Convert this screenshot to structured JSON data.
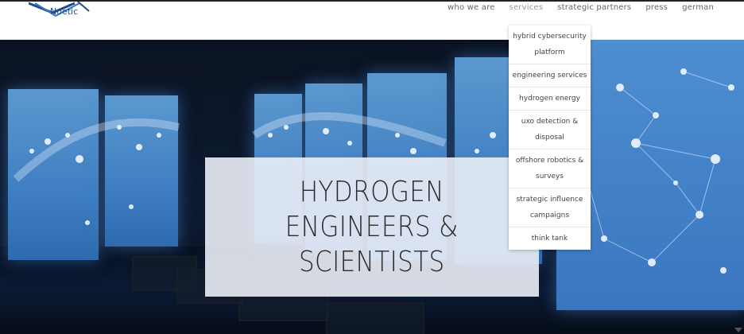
{
  "header": {
    "logo_text": "Noetic",
    "nav": [
      "who we are",
      "services",
      "strategic partners",
      "press",
      "german"
    ]
  },
  "hero": {
    "title_lines": [
      "HYDROGEN",
      "ENGINEERS &",
      "SCIENTISTS"
    ]
  },
  "services_menu": [
    "hybrid cybersecurity platform",
    "engineering services",
    "hydrogen energy",
    "uxo detection & disposal",
    "offshore robotics & surveys",
    "strategic influence campaigns",
    "think tank"
  ]
}
